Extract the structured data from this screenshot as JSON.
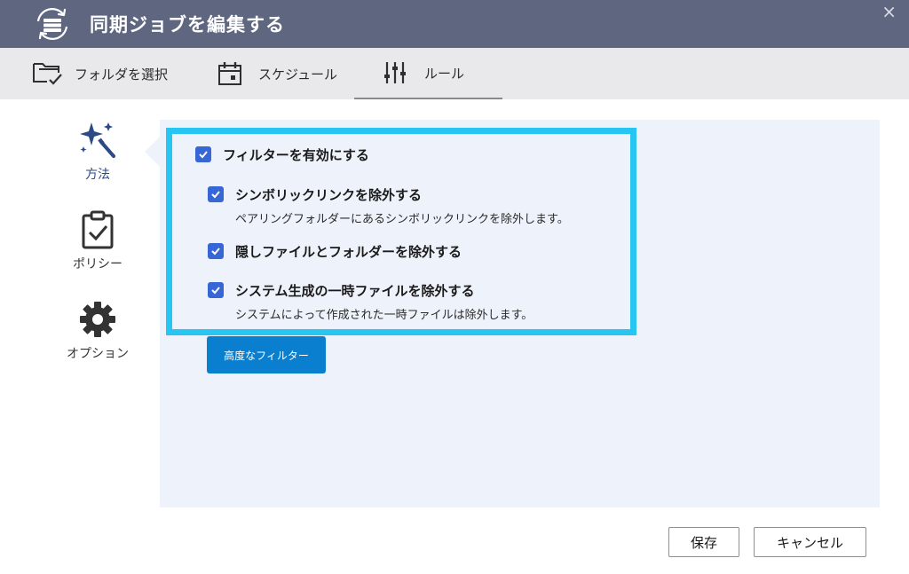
{
  "window": {
    "title": "同期ジョブを編集する",
    "close_glyph": "×",
    "app_icon": "sync-job-icon"
  },
  "tabs": [
    {
      "label": "フォルダを選択",
      "icon": "folder-sync-icon",
      "active": false
    },
    {
      "label": "スケジュール",
      "icon": "calendar-icon",
      "active": false
    },
    {
      "label": "ルール",
      "icon": "sliders-icon",
      "active": true
    }
  ],
  "sidenav": [
    {
      "label": "方法",
      "icon": "magic-wand-icon",
      "active": true
    },
    {
      "label": "ポリシー",
      "icon": "clipboard-check-icon",
      "active": false
    },
    {
      "label": "オプション",
      "icon": "gear-icon",
      "active": false
    }
  ],
  "filters": {
    "enable": {
      "label": "フィルターを有効にする",
      "checked": true
    },
    "symlinks": {
      "label": "シンボリックリンクを除外する",
      "description": "ペアリングフォルダーにあるシンボリックリンクを除外します。",
      "checked": true
    },
    "hidden": {
      "label": "隠しファイルとフォルダーを除外する",
      "checked": true
    },
    "temp": {
      "label": "システム生成の一時ファイルを除外する",
      "description": "システムによって作成された一時ファイルは除外します。",
      "checked": true
    }
  },
  "advanced_filter_button": "高度なフィルター",
  "footer": {
    "save": "保存",
    "cancel": "キャンセル"
  },
  "colors": {
    "titlebar": "#5f6680",
    "accent": "#3766d6",
    "highlight": "#27c6f2",
    "primary_button": "#0a7fcf",
    "panel": "#eef3fb"
  }
}
